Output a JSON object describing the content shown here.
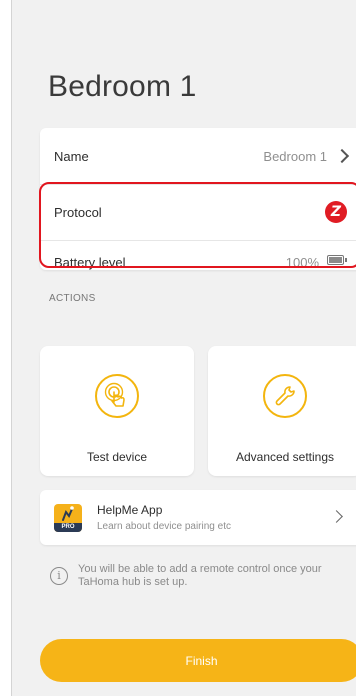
{
  "page": {
    "title": "Bedroom 1"
  },
  "details": {
    "name_label": "Name",
    "name_value": "Bedroom 1",
    "protocol_label": "Protocol",
    "protocol_icon": "z-wave-icon",
    "battery_label": "Battery level",
    "battery_value": "100%"
  },
  "actions": {
    "section_title": "ACTIONS",
    "test_device_label": "Test device",
    "advanced_settings_label": "Advanced settings"
  },
  "helpme": {
    "title": "HelpMe App",
    "subtitle": "Learn about device pairing etc",
    "badge": "PRO"
  },
  "info": {
    "text_line1": "You will be able to add a remote control once your",
    "text_line2": "TaHoma hub is set up."
  },
  "finish_label": "Finish",
  "colors": {
    "accent": "#f6b417",
    "highlight": "#e1161f",
    "zwave": "#e01c24"
  }
}
